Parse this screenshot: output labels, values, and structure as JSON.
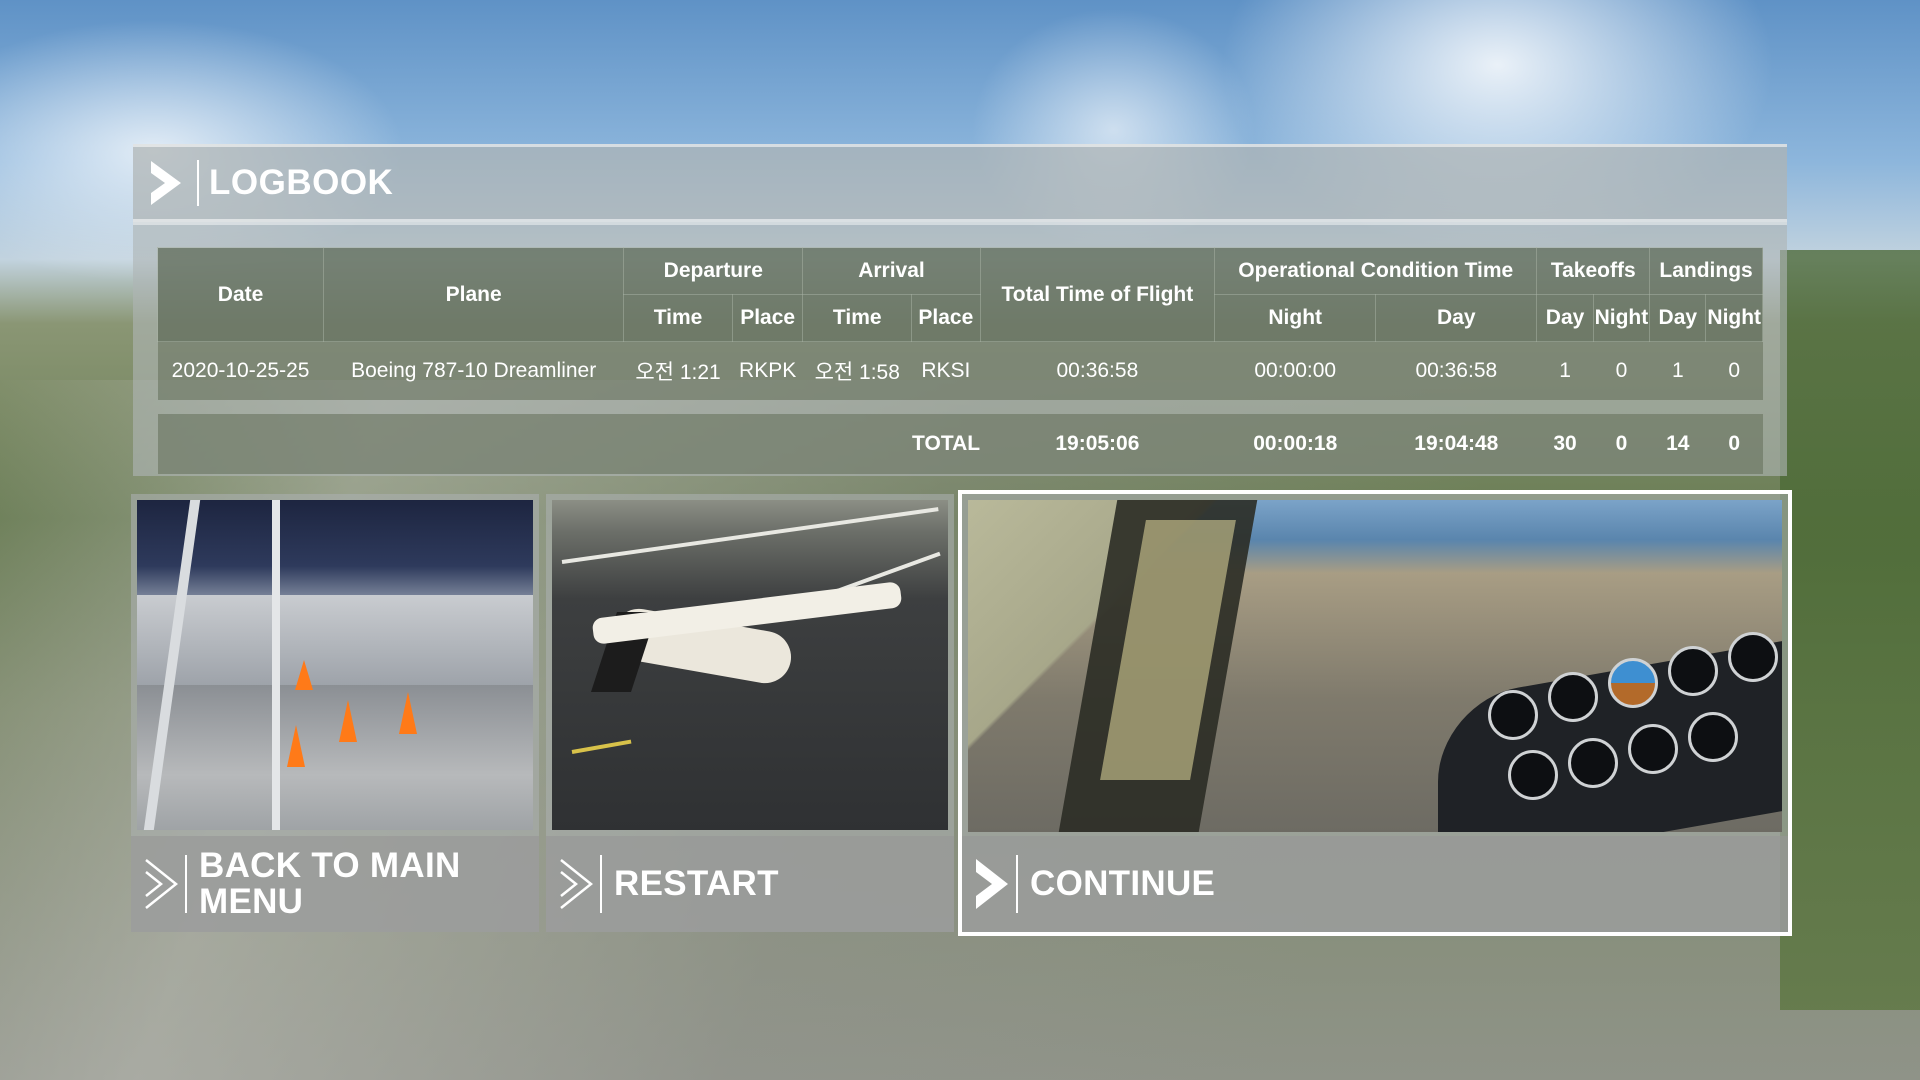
{
  "header": {
    "title": "LOGBOOK",
    "icon": "chevron-right-icon"
  },
  "table": {
    "columns": {
      "date": "Date",
      "plane": "Plane",
      "departure": "Departure",
      "arrival": "Arrival",
      "time": "Time",
      "place": "Place",
      "total_time_of_flight": "Total Time of Flight",
      "operational_condition_time": "Operational Condition Time",
      "night": "Night",
      "day": "Day",
      "takeoffs": "Takeoffs",
      "landings": "Landings"
    },
    "rows": [
      {
        "date": "2020-10-25-25",
        "plane": "Boeing 787-10 Dreamliner",
        "departure_time": "오전 1:21",
        "departure_place": "RKPK",
        "arrival_time": "오전 1:58",
        "arrival_place": "RKSI",
        "total_time": "00:36:58",
        "op_night": "00:00:00",
        "op_day": "00:36:58",
        "takeoffs_day": "1",
        "takeoffs_night": "0",
        "landings_day": "1",
        "landings_night": "0"
      }
    ],
    "total": {
      "label": "TOTAL",
      "total_time": "19:05:06",
      "op_night": "00:00:18",
      "op_day": "19:04:48",
      "takeoffs_day": "30",
      "takeoffs_night": "0",
      "landings_day": "14",
      "landings_night": "0"
    }
  },
  "actions": {
    "back": {
      "line1": "BACK TO MAIN",
      "line2": "MENU"
    },
    "restart": {
      "label": "RESTART"
    },
    "continue": {
      "label": "CONTINUE",
      "selected": true
    }
  },
  "colors": {
    "accent": "#ffffff",
    "panel": "#aeb3b3",
    "header_cell": "#5c6854"
  }
}
